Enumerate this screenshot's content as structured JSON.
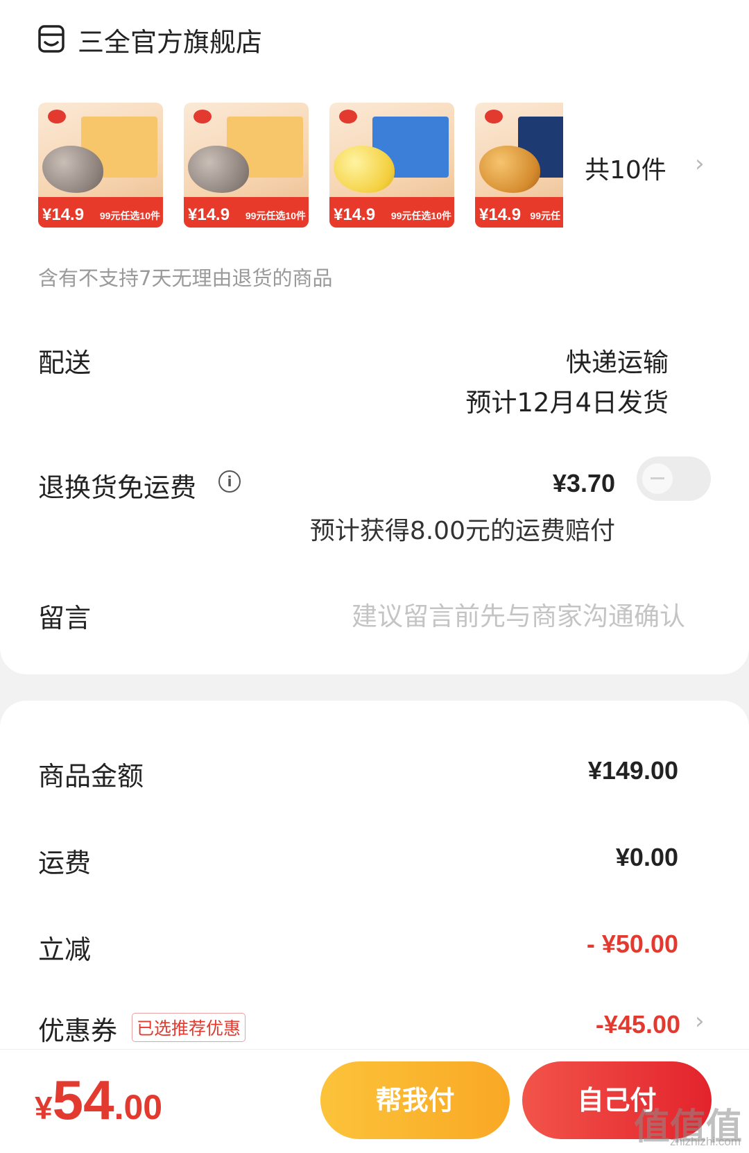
{
  "store": {
    "name": "三全官方旗舰店",
    "icon": "store-icon"
  },
  "products": {
    "thumbnails": [
      {
        "price": "¥14.9",
        "promo": "99元任选10件"
      },
      {
        "price": "¥14.9",
        "promo": "99元任选10件"
      },
      {
        "price": "¥14.9",
        "promo": "99元任选10件"
      },
      {
        "price": "¥14.9",
        "promo": "99元任"
      }
    ],
    "count_label": "共10件"
  },
  "notice": "含有不支持7天无理由退货的商品",
  "delivery": {
    "label": "配送",
    "method": "快递运输",
    "eta": "预计12月4日发货"
  },
  "return_shipping": {
    "label": "退换货免运费",
    "price": "¥3.70",
    "compensation": "预计获得8.00元的运费赔付",
    "toggle_on": false
  },
  "message": {
    "label": "留言",
    "placeholder": "建议留言前先与商家沟通确认"
  },
  "summary": {
    "goods": {
      "label": "商品金额",
      "value": "¥149.00"
    },
    "shipping": {
      "label": "运费",
      "value": "¥0.00"
    },
    "discount": {
      "label": "立减",
      "value": "- ¥50.00"
    },
    "coupon": {
      "label": "优惠券",
      "badge": "已选推荐优惠",
      "value": "-¥45.00"
    }
  },
  "footer": {
    "total_currency": "¥",
    "total_integer": "54",
    "total_decimal": ".00",
    "help_pay": "帮我付",
    "self_pay": "自己付"
  },
  "watermark": {
    "text": "值值值",
    "url": "zhizhizhi.com"
  },
  "colors": {
    "accent_red": "#e23a2f",
    "accent_yellow": "#fbb829"
  }
}
